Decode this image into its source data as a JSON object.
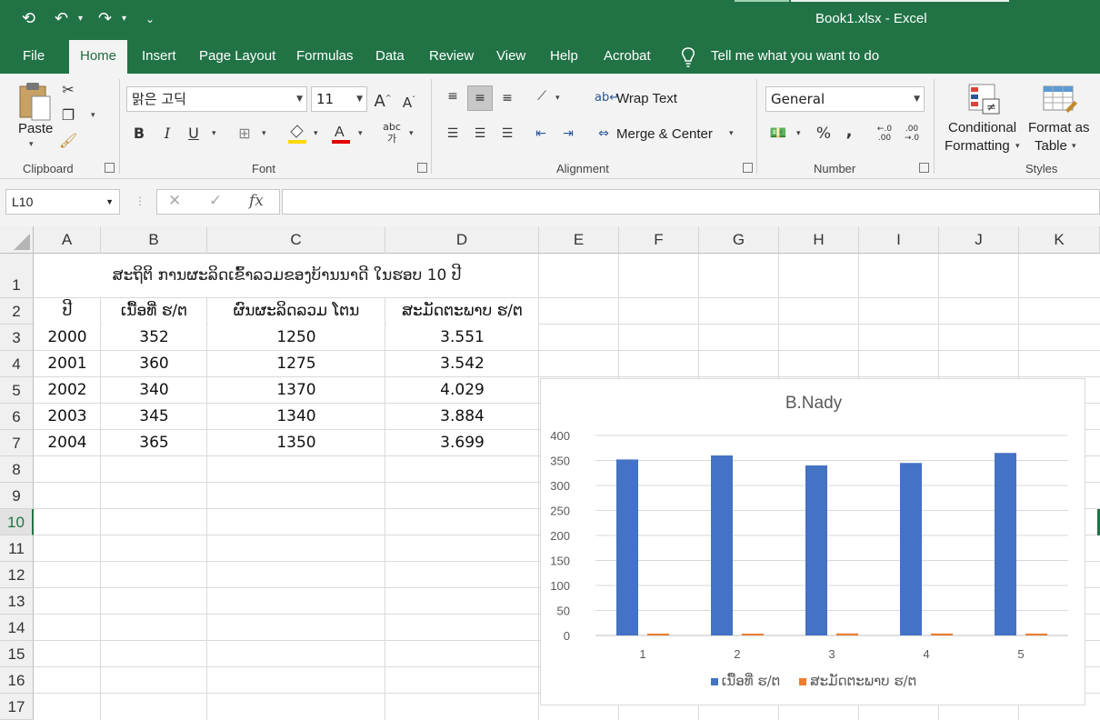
{
  "window": {
    "title": "Book1.xlsx  -  Excel"
  },
  "qat": {
    "autosave": "⟲",
    "undo": "↶",
    "redo": "↷",
    "customize": "⌄"
  },
  "tabs": [
    "File",
    "Home",
    "Insert",
    "Page Layout",
    "Formulas",
    "Data",
    "Review",
    "View",
    "Help",
    "Acrobat"
  ],
  "active_tab": "Home",
  "tell_me": "Tell me what you want to do",
  "ribbon": {
    "clipboard": {
      "paste": "Paste",
      "label": "Clipboard"
    },
    "font": {
      "name": "맑은 고딕",
      "size": "11",
      "grow": "A",
      "shrink": "A",
      "bold": "B",
      "italic": "I",
      "underline": "U",
      "label": "Font",
      "highlight_color": "#ffd800",
      "font_color": "#e00000"
    },
    "alignment": {
      "wrap": "Wrap Text",
      "merge": "Merge & Center",
      "label": "Alignment"
    },
    "number": {
      "format": "General",
      "percent": "%",
      "comma": ",",
      "label": "Number"
    },
    "styles": {
      "conditional_line1": "Conditional",
      "conditional_line2": "Formatting",
      "format_table_line1": "Format as",
      "format_table_line2": "Table",
      "label": "Styles"
    }
  },
  "formula_bar": {
    "name_box": "L10",
    "cancel": "✕",
    "enter": "✓",
    "fx": "fx",
    "value": ""
  },
  "columns": [
    "A",
    "B",
    "C",
    "D",
    "E",
    "F",
    "G",
    "H",
    "I",
    "J",
    "K"
  ],
  "rows": [
    "1",
    "2",
    "3",
    "4",
    "5",
    "6",
    "7",
    "8",
    "9",
    "10",
    "11",
    "12",
    "13",
    "14",
    "15",
    "16",
    "17"
  ],
  "selected_row": "10",
  "sheet": {
    "title": "ສະຖິຕິ ການຜະລິດເຂົ້າລວມຂອງບ້ານນາດີ ໃນຮອບ 10 ປີ",
    "headers": [
      "ປີ",
      "ເນື້ອທີ່ ຮ/ຕ",
      "ຜົນຜະລິດລວມ ໂຕນ",
      "ສະມັດຕະພາບ ຮ/ຕ"
    ],
    "data": [
      [
        "2000",
        "352",
        "1250",
        "3.551"
      ],
      [
        "2001",
        "360",
        "1275",
        "3.542"
      ],
      [
        "2002",
        "340",
        "1370",
        "4.029"
      ],
      [
        "2003",
        "345",
        "1340",
        "3.884"
      ],
      [
        "2004",
        "365",
        "1350",
        "3.699"
      ]
    ]
  },
  "chart_data": {
    "type": "bar",
    "title": "B.Nady",
    "categories": [
      "1",
      "2",
      "3",
      "4",
      "5"
    ],
    "series": [
      {
        "name": "ເນື້ອທີ່ ຮ/ຕ",
        "values": [
          352,
          360,
          340,
          345,
          365
        ],
        "color": "#4472c4"
      },
      {
        "name": "ສະມັດຕະພາບ ຮ/ຕ",
        "values": [
          3.551,
          3.542,
          4.029,
          3.884,
          3.699
        ],
        "color": "#ed7d31"
      }
    ],
    "ylim": [
      0,
      400
    ],
    "yticks": [
      "0",
      "50",
      "100",
      "150",
      "200",
      "250",
      "300",
      "350",
      "400"
    ],
    "grid": true,
    "legend": "bottom"
  }
}
